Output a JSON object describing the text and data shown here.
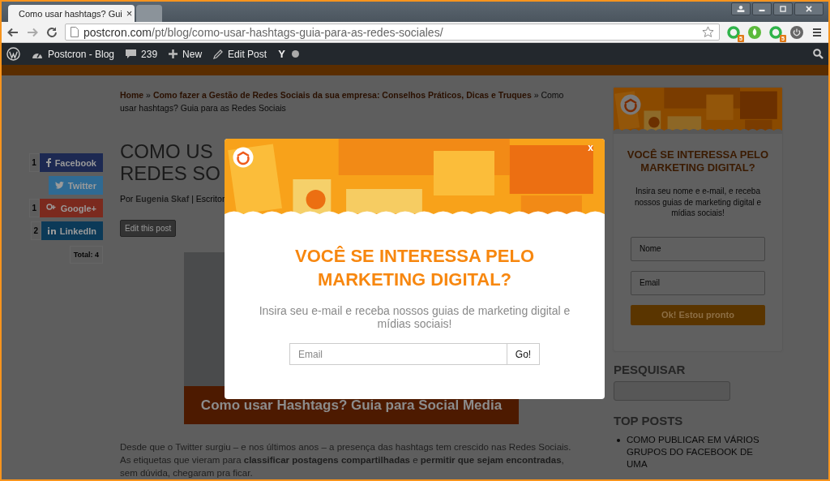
{
  "browser": {
    "tabs": [
      {
        "title": "Como usar hashtags? Gui",
        "close": "×",
        "selected": true
      },
      {
        "selected": false
      }
    ],
    "address": {
      "domain": "postcron.com",
      "path": "/pt/blog/como-usar-hashtags-guia-para-as-redes-sociales/"
    },
    "extensions": [
      {
        "kind": "ring",
        "badge": "5"
      },
      {
        "kind": "leaf"
      },
      {
        "kind": "ring",
        "badge": "5"
      },
      {
        "kind": "power"
      }
    ]
  },
  "admin_bar": {
    "site": "Postcron - Blog",
    "comments": "239",
    "new": "New",
    "edit": "Edit Post",
    "yoast": "Y"
  },
  "breadcrumb": {
    "links": [
      "Home",
      "Como fazer a Gestão de Redes Sociais da sua empresa: Conselhos Práticos, Dicas e Truques"
    ],
    "separator": "»",
    "current": "Como usar hashtags? Guia para as Redes Sociais"
  },
  "share": {
    "buttons": [
      {
        "kind": "facebook",
        "label": "Facebook",
        "count": "1",
        "color": "#1d2952"
      },
      {
        "kind": "twitter",
        "label": "Twitter",
        "color": "#2f6a93"
      },
      {
        "kind": "google",
        "label": "Google+",
        "count": "1",
        "color": "#7b2a1e"
      },
      {
        "kind": "linkedin",
        "label": "LinkedIn",
        "count": "2",
        "color": "#0c3a58"
      }
    ],
    "total": "Total: 4"
  },
  "post": {
    "title_lines": [
      "COMO US",
      "REDES SO"
    ],
    "byline_prefix": "Por",
    "author": "Eugenia Skaf",
    "role": "| Escritor",
    "edit_button": "Edit this post",
    "image_caption": "Como usar Hashtags? Guia para Social Media",
    "paragraph": "Desde que o Twitter surgiu – e nos últimos anos – a presença das hashtags tem crescido nas Redes Sociais. As etiquetas que vieram para **classificar postagens compartilhadas** e **permitir que sejam encontradas**, sem dúvida, chegaram pra ficar."
  },
  "modal": {
    "close": "x",
    "title": "VOCÊ SE INTERESSA PELO MARKETING DIGITAL?",
    "text": "Insira seu e-mail e receba nossos guias de marketing digital e mídias sociais!",
    "email_placeholder": "Email",
    "button": "Go!"
  },
  "sidebar": {
    "widget": {
      "title": "VOCÊ SE INTERESSA PELO MARKETING DIGITAL?",
      "text": "Insira seu nome e e-mail, e receba nossos guias de marketing digital e mídias sociais!",
      "name_placeholder": "Nome",
      "email_placeholder": "Email",
      "button": "Ok! Estou pronto"
    },
    "search_title": "PESQUISAR",
    "top_posts_title": "TOP POSTS",
    "top_posts": [
      "COMO PUBLICAR EM VÁRIOS GRUPOS DO FACEBOOK DE UMA"
    ]
  }
}
